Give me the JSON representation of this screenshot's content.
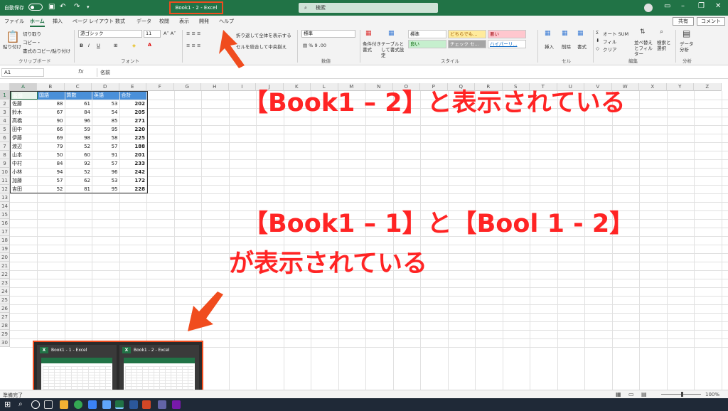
{
  "titlebar": {
    "autosave_label": "自動保存",
    "autosave_state": "オフ",
    "doc_title": "Book1 - 2 - Excel",
    "search_placeholder": "検索"
  },
  "tabs": [
    "ファイル",
    "ホーム",
    "挿入",
    "ページ レイアウト",
    "数式",
    "データ",
    "校閲",
    "表示",
    "開発",
    "ヘルプ"
  ],
  "active_tab": "ホーム",
  "share_label": "共有",
  "comment_label": "コメント",
  "ribbon": {
    "clipboard": {
      "paste": "貼り付け",
      "cut": "切り取り",
      "copy": "コピー・",
      "format_painter": "書式のコピー/貼り付け",
      "group": "クリップボード"
    },
    "font": {
      "name": "游ゴシック",
      "size": "11",
      "group": "フォント"
    },
    "alignment": {
      "wrap": "折り返して全体を表示する",
      "merge": "セルを結合して中央揃え"
    },
    "number": {
      "format": "標準",
      "group": "数値"
    },
    "styles": {
      "conditional": "条件付き書式",
      "table": "テーブルとして書式設定",
      "cells": [
        {
          "label": "標準",
          "bg": "#ffffff",
          "fg": "#222222"
        },
        {
          "label": "どちらでも...",
          "bg": "#ffeb9c",
          "fg": "#9c5700"
        },
        {
          "label": "悪い",
          "bg": "#ffc7ce",
          "fg": "#9c0006"
        },
        {
          "label": "良い",
          "bg": "#c6efce",
          "fg": "#006100"
        },
        {
          "label": "チェック セ...",
          "bg": "#a5a5a5",
          "fg": "#ffffff"
        },
        {
          "label": "ハイパーリ...",
          "bg": "#ffffff",
          "fg": "#0563c1"
        }
      ],
      "group": "スタイル"
    },
    "cells": {
      "insert": "挿入",
      "delete": "削除",
      "format": "書式",
      "group": "セル"
    },
    "editing": {
      "autosum": "オート SUM",
      "fill": "フィル",
      "clear": "クリア",
      "sort": "並べ替えとフィルター",
      "find": "検索と選択",
      "group": "編集"
    },
    "analysis": {
      "analyze": "データ分析",
      "group": "分析"
    }
  },
  "formula_bar": {
    "name_box": "A1",
    "value": "名前"
  },
  "columns": [
    "A",
    "B",
    "C",
    "D",
    "E",
    "F",
    "G",
    "H",
    "I",
    "J",
    "K",
    "L",
    "M",
    "N",
    "O",
    "P",
    "Q",
    "R",
    "S",
    "T",
    "U",
    "V",
    "W",
    "X",
    "Y",
    "Z"
  ],
  "rows": [
    "1",
    "2",
    "3",
    "4",
    "5",
    "6",
    "7",
    "8",
    "9",
    "10",
    "11",
    "12",
    "13",
    "14",
    "15",
    "16",
    "17",
    "18",
    "19",
    "20",
    "21",
    "22",
    "23",
    "24",
    "25",
    "26",
    "27",
    "28",
    "29",
    "30"
  ],
  "table": {
    "headers": [
      "名前",
      "国語",
      "算数",
      "英語",
      "合計"
    ],
    "rows": [
      [
        "佐藤",
        "88",
        "61",
        "53",
        "202"
      ],
      [
        "鈴木",
        "67",
        "84",
        "54",
        "205"
      ],
      [
        "高橋",
        "90",
        "96",
        "85",
        "271"
      ],
      [
        "田中",
        "66",
        "59",
        "95",
        "220"
      ],
      [
        "伊藤",
        "69",
        "98",
        "58",
        "225"
      ],
      [
        "渡辺",
        "79",
        "52",
        "57",
        "188"
      ],
      [
        "山本",
        "50",
        "60",
        "91",
        "201"
      ],
      [
        "中村",
        "84",
        "92",
        "57",
        "233"
      ],
      [
        "小林",
        "94",
        "52",
        "96",
        "242"
      ],
      [
        "加藤",
        "57",
        "62",
        "53",
        "172"
      ],
      [
        "吉田",
        "52",
        "81",
        "95",
        "228"
      ]
    ]
  },
  "annotations": {
    "a1": "【Book1 – 2】と表示されている",
    "a2": "【Book1 – 1】と【Bool 1 - 2】",
    "a3": "が表示されている"
  },
  "previews": [
    {
      "title": "Book1 - 1 - Excel"
    },
    {
      "title": "Book1 - 2 - Excel"
    }
  ],
  "status": {
    "ready": "準備完了",
    "zoom": "100%"
  },
  "colors": {
    "excel_green": "#217346",
    "highlight": "#f04c1e",
    "annotation": "#ff2424"
  }
}
